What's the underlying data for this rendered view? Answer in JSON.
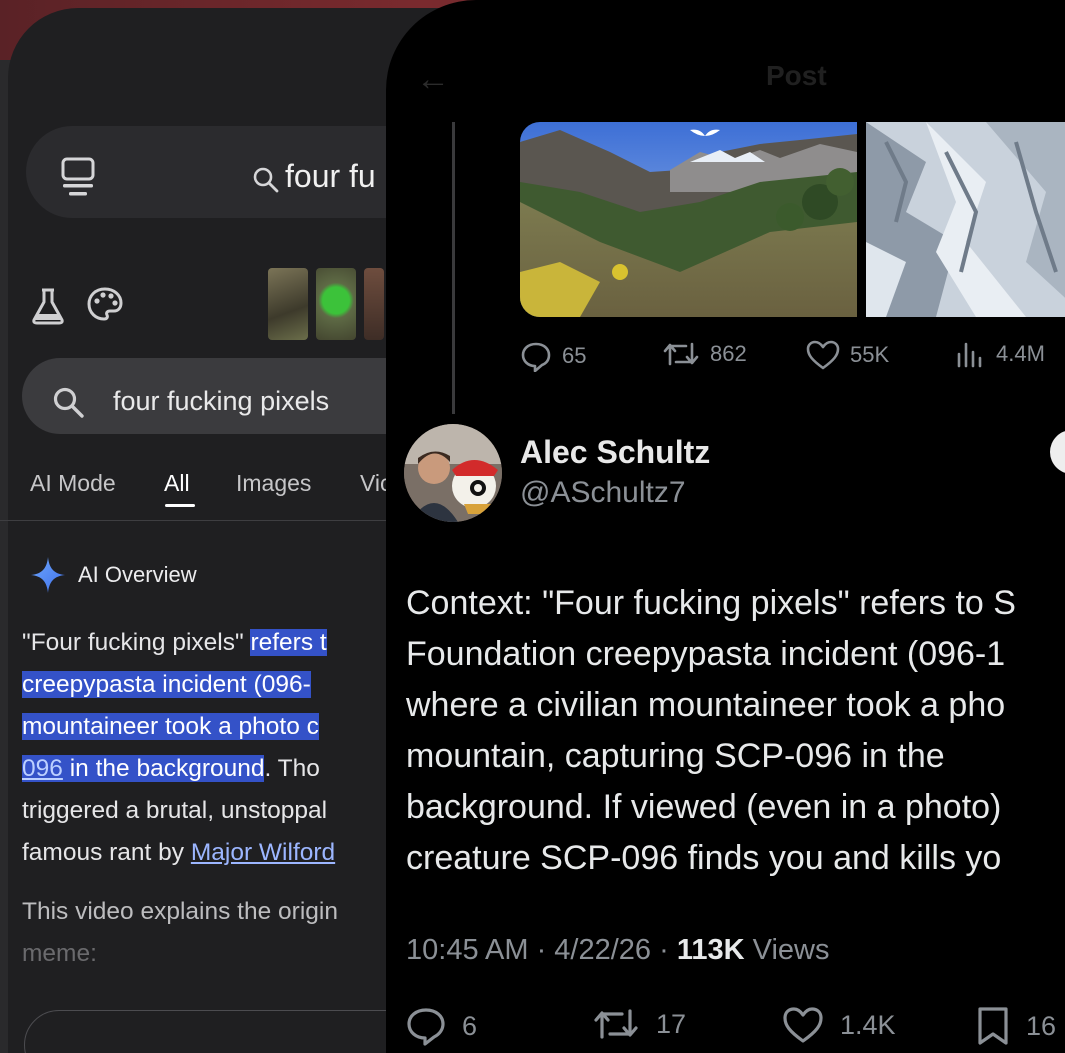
{
  "google": {
    "query": "four fu",
    "search_bar_text": "four fucking pixels",
    "tabs": [
      {
        "label": "AI Mode"
      },
      {
        "label": "All"
      },
      {
        "label": "Images"
      },
      {
        "label": "Vic"
      }
    ],
    "ai_overview_title": "AI Overview",
    "overview": {
      "line1_plain": "\"Four fucking pixels\" ",
      "line1_hl": "refers t",
      "line2_hl": "creepypasta incident (096-",
      "line3_hl": "mountaineer took a photo c",
      "line4_link": "096",
      "line4_hl": " in the background",
      "line4_rest": ". Tho",
      "line5": "triggered a brutal, unstoppal",
      "line6_plain": "famous rant by ",
      "line6_link": "Major Wilford"
    },
    "video_line1": "This video explains the origin",
    "video_line2": "meme:"
  },
  "x": {
    "header_title": "Post",
    "quoted_stats": {
      "replies": "65",
      "reposts": "862",
      "likes": "55K",
      "views": "4.4M"
    },
    "author_name": "Alec Schultz",
    "author_handle": "@ASchultz7",
    "body_lines": [
      "Context: \"Four fucking pixels\" refers to S",
      "Foundation creepypasta incident (096-1",
      "where a civilian mountaineer took a pho",
      "mountain, capturing SCP-096 in the",
      "background. If viewed (even in a photo)",
      "creature SCP-096 finds you and kills yo"
    ],
    "meta_time": "10:45 AM · 4/22/26 · ",
    "meta_views_count": "113K",
    "meta_views_label": " Views",
    "actions": {
      "replies": "6",
      "reposts": "17",
      "likes": "1.4K",
      "bookmarks": "16"
    }
  },
  "colors": {
    "highlight": "#3452c8",
    "link": "#9cb6ff",
    "x_text": "#e7e9ea",
    "x_muted": "#8b9096"
  }
}
